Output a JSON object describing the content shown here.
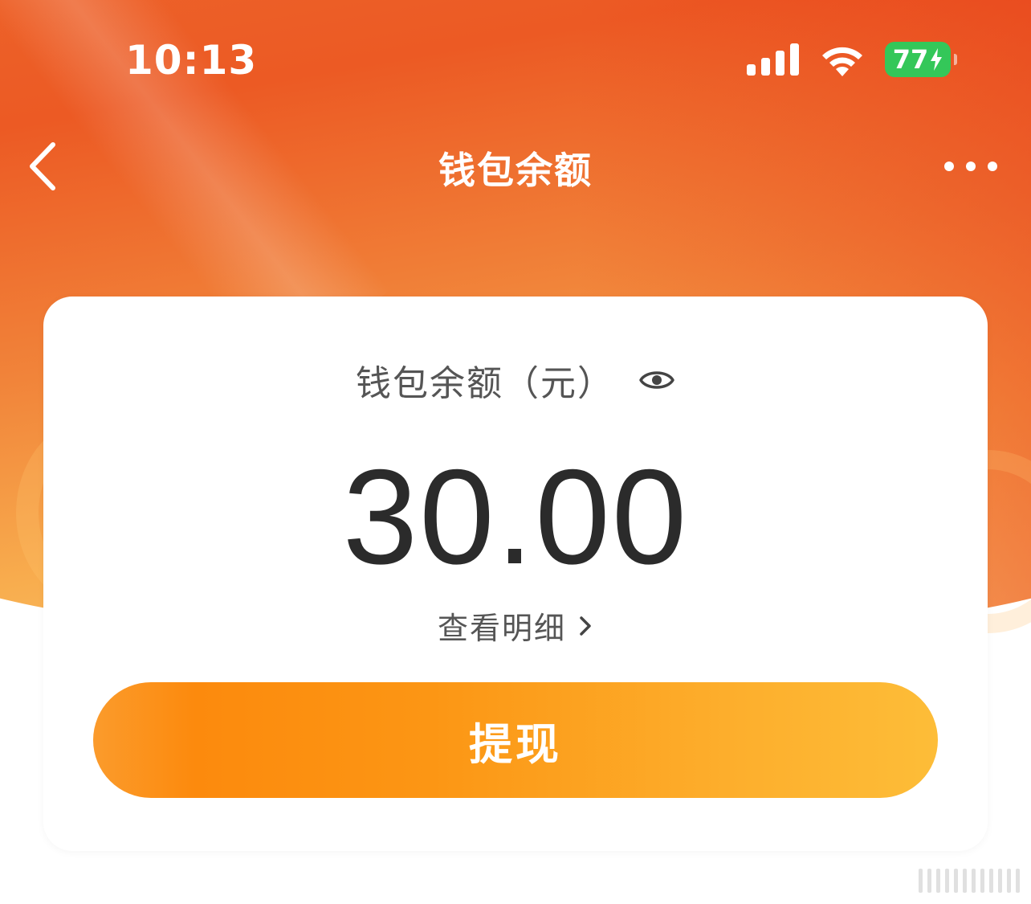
{
  "status_bar": {
    "time": "10:13",
    "battery_level": "77",
    "battery_color": "#34c759",
    "icons": [
      "signal-icon",
      "wifi-icon",
      "battery-charging-icon"
    ]
  },
  "nav": {
    "title": "钱包余额",
    "back_icon": "chevron-left-icon",
    "more_icon": "more-dots-icon"
  },
  "card": {
    "balance_label": "钱包余额（元）",
    "eye_icon": "eye-icon",
    "balance_amount": "30.00",
    "detail_link_label": "查看明细",
    "withdraw_button_label": "提现"
  },
  "colors": {
    "header_orange": "#ec5a24",
    "button_orange": "#fc8a0d",
    "button_yellow": "#fdbd38",
    "text_dark": "#2b2b2b",
    "text_gray": "#555555"
  }
}
